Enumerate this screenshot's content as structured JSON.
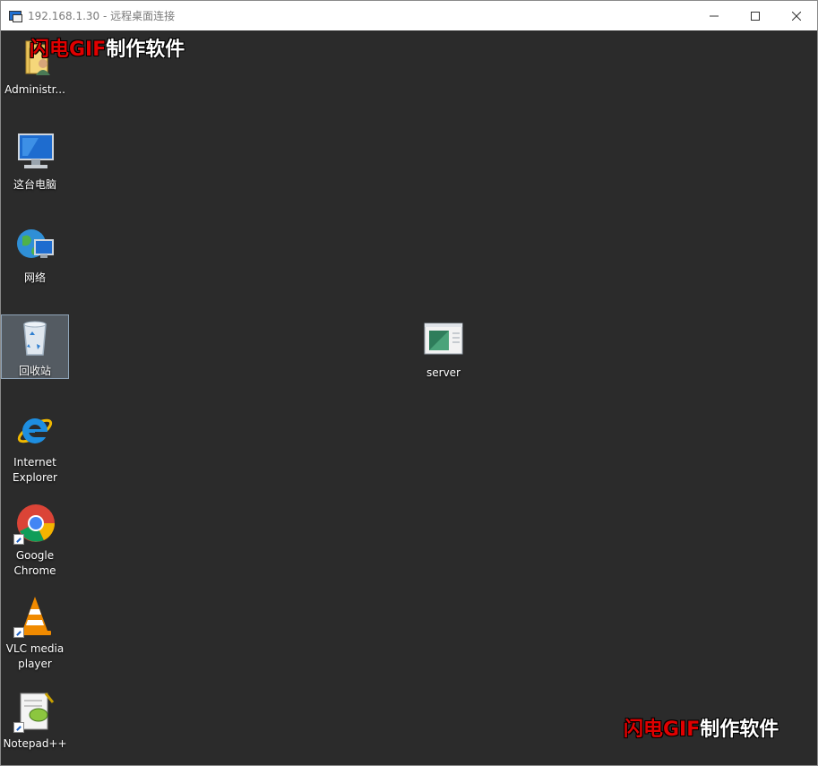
{
  "window": {
    "title": "192.168.1.30 - 远程桌面连接",
    "controls": {
      "minimize": "minimize",
      "maximize": "maximize",
      "close": "close"
    }
  },
  "watermark": {
    "red": "闪电GIF",
    "white": "制作软件"
  },
  "desktop": {
    "icons": [
      {
        "label": "Administr...",
        "icon": "user-folder-icon",
        "selected": false,
        "shortcut": false
      },
      {
        "label": "这台电脑",
        "icon": "computer-icon",
        "selected": false,
        "shortcut": false
      },
      {
        "label": "网络",
        "icon": "network-icon",
        "selected": false,
        "shortcut": false
      },
      {
        "label": "回收站",
        "icon": "recycle-bin-icon",
        "selected": true,
        "shortcut": false
      },
      {
        "label": "Internet Explorer",
        "icon": "internet-explorer-icon",
        "selected": false,
        "shortcut": false
      },
      {
        "label": "Google Chrome",
        "icon": "chrome-icon",
        "selected": false,
        "shortcut": true
      },
      {
        "label": "VLC media player",
        "icon": "vlc-icon",
        "selected": false,
        "shortcut": true
      },
      {
        "label": "Notepad++",
        "icon": "notepad-plus-plus-icon",
        "selected": false,
        "shortcut": true
      },
      {
        "label": "server",
        "icon": "rdp-file-icon",
        "selected": false,
        "shortcut": false
      }
    ]
  },
  "colors": {
    "desktop_background": "#2b2b2b",
    "titlebar": "#ffffff",
    "watermark_red": "#e00000",
    "selection": "#8fa4b8"
  }
}
